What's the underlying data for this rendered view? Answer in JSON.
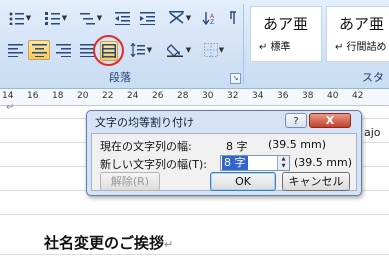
{
  "ribbon": {
    "paragraph_group_label": "段落",
    "styles_group_label": "スタ",
    "style_tiles": [
      {
        "preview": "あア亜",
        "name": "↵ 標準"
      },
      {
        "preview": "あア亜",
        "name": "↵ 行間詰め"
      }
    ],
    "highlight_color": "#f8c95a",
    "annotation_color": "#e22b2b"
  },
  "ruler": {
    "ticks": [
      "14",
      "16",
      "18",
      "20",
      "22",
      "24",
      "26",
      "28",
      "30",
      "32",
      "34",
      "36",
      "38",
      "40",
      "42"
    ]
  },
  "document": {
    "heading": "社名変更のご挨拶",
    "partial_text_left": "↵",
    "partial_text_right": "ajo"
  },
  "dialog": {
    "title": "文字の均等割り付け",
    "help_label": "?",
    "close_label": "X",
    "current_width_label": "現在の文字列の幅:",
    "current_width_value": "8 字",
    "current_width_mm": "(39.5 mm)",
    "new_width_label": "新しい文字列の幅(T):",
    "new_width_value": "8 字",
    "new_width_mm": "(39.5 mm)",
    "remove_button": "解除(R)",
    "ok_button": "OK",
    "cancel_button": "キャンセル"
  }
}
